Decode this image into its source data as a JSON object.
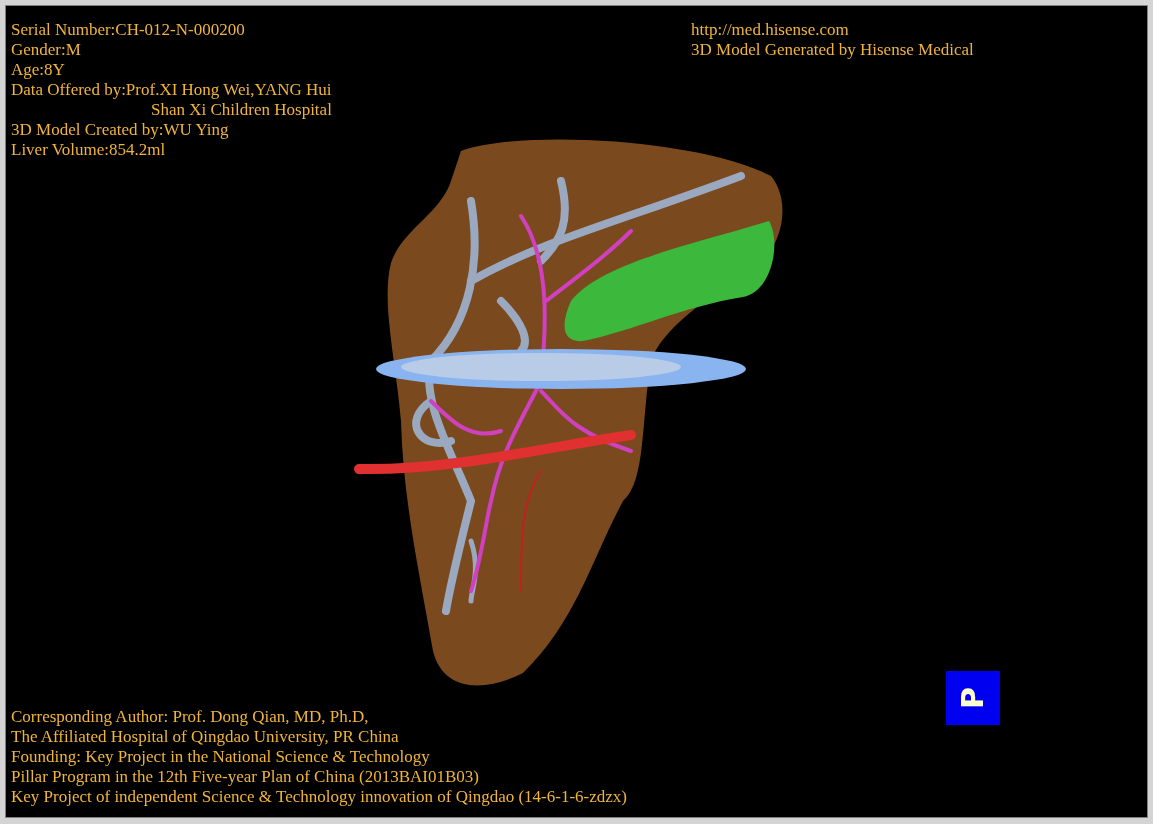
{
  "info_top_left": [
    {
      "kind": "line",
      "text": "Serial Number:CH-012-N-000200"
    },
    {
      "kind": "line",
      "text": "Gender:M"
    },
    {
      "kind": "line",
      "text": "Age:8Y"
    },
    {
      "kind": "line",
      "text": "Data Offered by:Prof.XI Hong Wei,YANG Hui"
    },
    {
      "kind": "continuation",
      "text": "Shan Xi Children Hospital"
    },
    {
      "kind": "line",
      "text": "3D Model Created by:WU Ying"
    },
    {
      "kind": "line",
      "text": "Liver Volume:854.2ml"
    }
  ],
  "info_top_right": [
    "http://med.hisense.com",
    "3D Model Generated by Hisense Medical"
  ],
  "info_bottom": [
    "Corresponding Author: Prof. Dong Qian, MD, Ph.D,",
    "The Affiliated Hospital of Qingdao University, PR China",
    "Founding: Key Project in the National Science & Technology",
    "Pillar Program in the 12th Five-year Plan of China (2013BAI01B03)",
    "Key Project of independent Science & Technology innovation of Qingdao (14-6-1-6-zdzx)"
  ],
  "orientation_cube": {
    "label": "P"
  }
}
